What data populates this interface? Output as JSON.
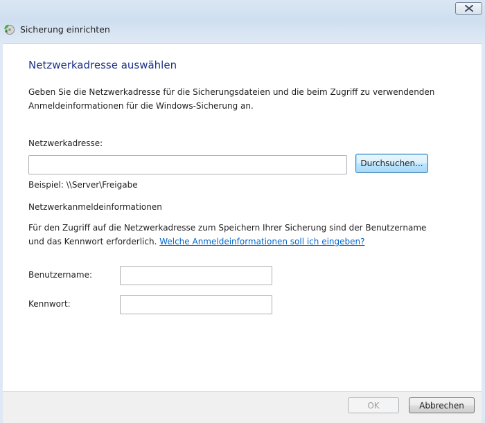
{
  "window": {
    "title": "Sicherung einrichten",
    "close_icon": "close-icon"
  },
  "page": {
    "heading": "Netzwerkadresse auswählen",
    "intro_line1": "Geben Sie die Netzwerkadresse für die Sicherungsdateien und die beim Zugriff zu verwendenden",
    "intro_line2": "Anmeldeinformationen für die Windows-Sicherung an.",
    "network_address_label": "Netzwerkadresse:",
    "network_address_value": "",
    "browse_label": "Durchsuchen...",
    "example_text": "Beispiel: \\\\Server\\Freigabe",
    "credentials_heading": "Netzwerkanmeldeinformationen",
    "credentials_line1": "Für den Zugriff auf die Netzwerkadresse zum Speichern Ihrer Sicherung sind der Benutzername",
    "credentials_line2_prefix": "und das Kennwort erforderlich. ",
    "credentials_help_link": "Welche Anmeldeinformationen soll ich eingeben?",
    "username_label": "Benutzername:",
    "username_value": "",
    "password_label": "Kennwort:",
    "password_value": ""
  },
  "footer": {
    "ok_label": "OK",
    "cancel_label": "Abbrechen"
  },
  "colors": {
    "heading": "#1e3287",
    "link": "#0066cc",
    "focus_button": "#a7d9f5"
  }
}
